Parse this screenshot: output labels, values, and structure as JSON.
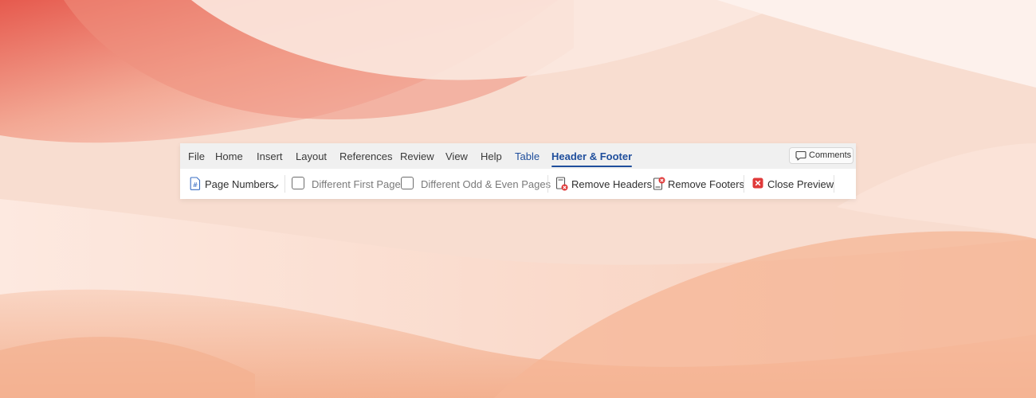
{
  "tabs": [
    {
      "label": "File"
    },
    {
      "label": "Home"
    },
    {
      "label": "Insert"
    },
    {
      "label": "Layout"
    },
    {
      "label": "References"
    },
    {
      "label": "Review"
    },
    {
      "label": "View"
    },
    {
      "label": "Help"
    },
    {
      "label": "Table"
    },
    {
      "label": "Header & Footer"
    }
  ],
  "active_tab": "Header & Footer",
  "comments": {
    "label": "Comments",
    "icon": "comment-icon"
  },
  "toolbar": {
    "page_numbers": {
      "label": "Page Numbers",
      "icon": "page-number-icon"
    },
    "different_first_page": {
      "label": "Different First Page",
      "checked": false
    },
    "different_odd_even": {
      "label": "Different Odd & Even Pages",
      "checked": false
    },
    "remove_headers": {
      "label": "Remove Headers",
      "icon": "remove-header-icon"
    },
    "remove_footers": {
      "label": "Remove Footers",
      "icon": "remove-footer-icon"
    },
    "close_preview": {
      "label": "Close Preview",
      "icon": "close-icon"
    }
  },
  "colors": {
    "accent": "#1f4e9c",
    "close_red": "#e03a3a",
    "wallpaper_red": "#e8685a",
    "wallpaper_peach": "#f6c5b0"
  }
}
